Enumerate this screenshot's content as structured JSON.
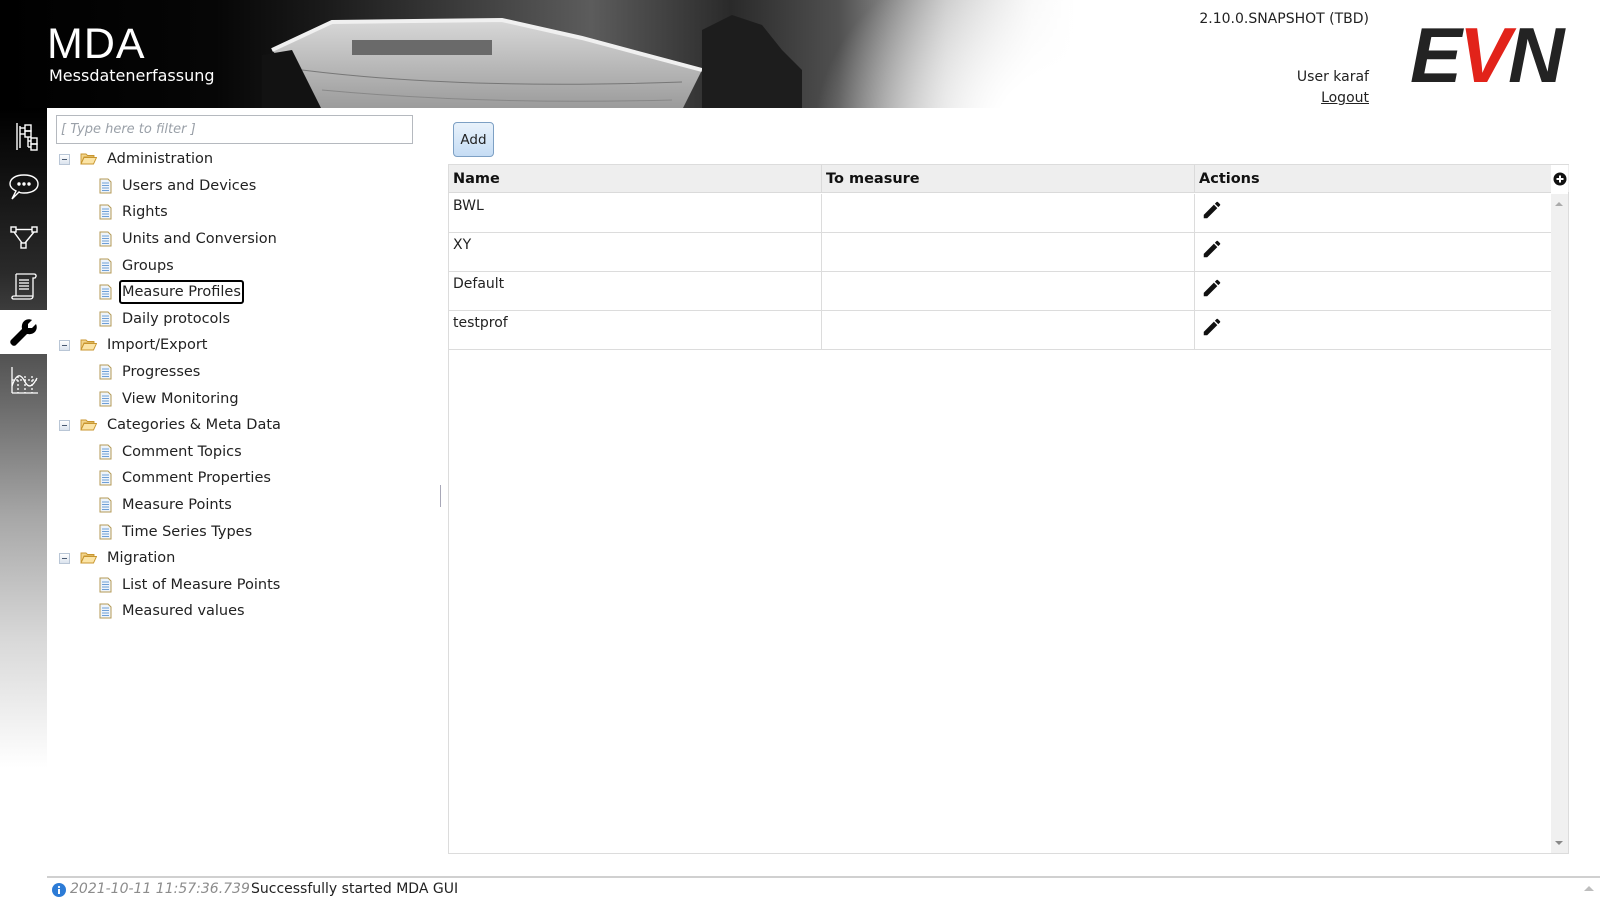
{
  "header": {
    "app_title": "MDA",
    "app_subtitle": "Messdatenerfassung",
    "version": "2.10.0.SNAPSHOT (TBD)",
    "user_label": "User karaf",
    "logout_label": "Logout",
    "logo": {
      "e": "E",
      "v": "V",
      "n": "N"
    },
    "colors": {
      "logo_dark": "#232323",
      "logo_red": "#e2231a"
    }
  },
  "rail": {
    "items": [
      {
        "icon": "hierarchy-tree-icon",
        "active": false
      },
      {
        "icon": "speech-bubble-icon",
        "active": false
      },
      {
        "icon": "network-graph-icon",
        "active": false
      },
      {
        "icon": "scroll-document-icon",
        "active": false
      },
      {
        "icon": "wrench-icon",
        "active": true
      },
      {
        "icon": "line-chart-icon",
        "active": false
      }
    ]
  },
  "tree": {
    "filter_placeholder": "[ Type here to filter ]",
    "filter_value": "",
    "groups": [
      {
        "label": "Administration",
        "expanded": true,
        "items": [
          "Users and Devices",
          "Rights",
          "Units and Conversion",
          "Groups",
          "Measure Profiles",
          "Daily protocols"
        ]
      },
      {
        "label": "Import/Export",
        "expanded": true,
        "items": [
          "Progresses",
          "View Monitoring"
        ]
      },
      {
        "label": "Categories & Meta Data",
        "expanded": true,
        "items": [
          "Comment Topics",
          "Comment Properties",
          "Measure Points",
          "Time Series Types"
        ]
      },
      {
        "label": "Migration",
        "expanded": true,
        "items": [
          "List of Measure Points",
          "Measured values"
        ]
      }
    ],
    "selected": "Measure Profiles"
  },
  "main": {
    "add_label": "Add",
    "columns": [
      "Name",
      "To measure",
      "Actions"
    ],
    "rows": [
      {
        "name": "BWL",
        "to_measure": "",
        "action_icon": "pencil-edit-icon"
      },
      {
        "name": "XY",
        "to_measure": "",
        "action_icon": "pencil-edit-icon"
      },
      {
        "name": "Default",
        "to_measure": "",
        "action_icon": "pencil-edit-icon"
      },
      {
        "name": "testprof",
        "to_measure": "",
        "action_icon": "pencil-edit-icon"
      }
    ]
  },
  "status": {
    "icon": "info-icon",
    "timestamp": "2021-10-11 11:57:36.739",
    "message": "Successfully started MDA GUI"
  }
}
